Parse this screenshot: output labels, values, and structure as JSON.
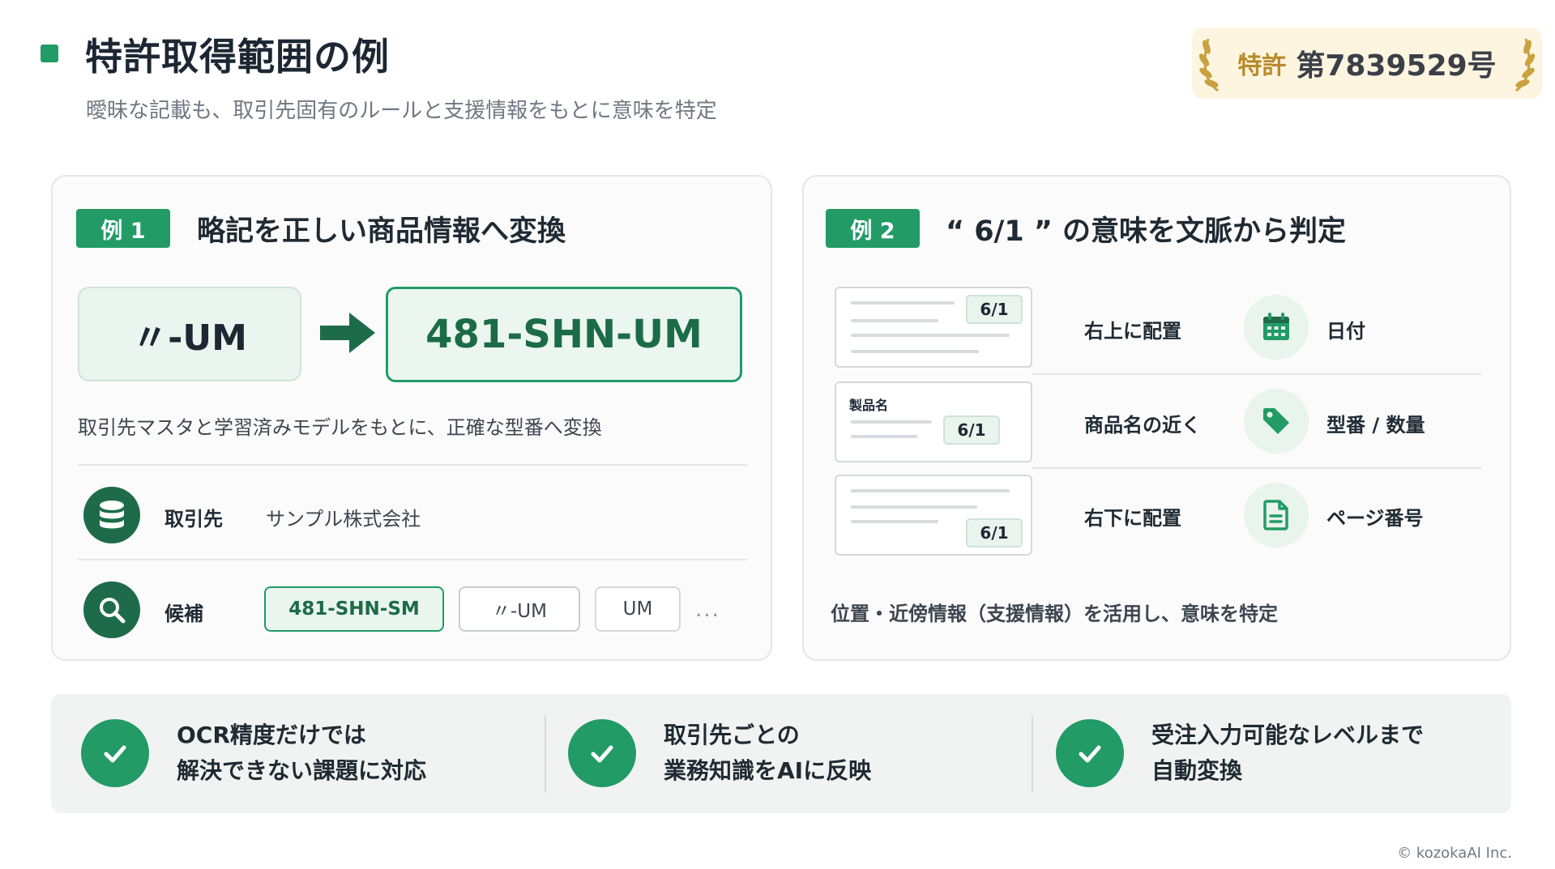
{
  "header": {
    "title": "特許取得範囲の例",
    "subtitle": "曖昧な記載も、取引先固有のルールと支援情報をもとに意味を特定"
  },
  "patent": {
    "label": "特許",
    "number": "第7839529号"
  },
  "example1": {
    "tag": "例 1",
    "title": "略記を正しい商品情報へ変換",
    "abbreviation": "〃-UM",
    "result": "481-SHN-UM",
    "note": "取引先マスタと学習済みモデルをもとに、正確な型番へ変換",
    "client_label": "取引先",
    "client_value": "サンプル株式会社",
    "candidates_label": "候補",
    "candidates": [
      "481-SHN-SM",
      "〃-UM",
      "UM"
    ],
    "more": "..."
  },
  "example2": {
    "tag": "例 2",
    "title": "“ 6/1 ” の意味を文脈から判定",
    "rows": [
      {
        "badge": "6/1",
        "position": "右上に配置",
        "icon": "calendar-icon",
        "meaning": "日付"
      },
      {
        "badge": "6/1",
        "doc_label": "製品名",
        "position": "商品名の近く",
        "icon": "tag-icon",
        "meaning": "型番 / 数量"
      },
      {
        "badge": "6/1",
        "position": "右下に配置",
        "icon": "document-icon",
        "meaning": "ページ番号"
      }
    ],
    "note": "位置・近傍情報（支援情報）を活用し、意味を特定"
  },
  "summary": [
    {
      "line1": "OCR精度だけでは",
      "line2": "解決できない課題に対応"
    },
    {
      "line1": "取引先ごとの",
      "line2": "業務知識をAIに反映"
    },
    {
      "line1": "受注入力可能なレベルまで",
      "line2": "自動変換"
    }
  ],
  "footer": {
    "copyright": "© kozokaAI Inc."
  },
  "colors": {
    "accent": "#229b67",
    "dark_green": "#1e6b4a",
    "badge_bg": "#fdf5e0",
    "gold": "#b78a2a"
  }
}
